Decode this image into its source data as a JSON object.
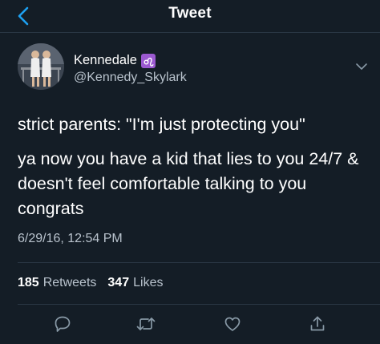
{
  "nav": {
    "title": "Tweet"
  },
  "user": {
    "display_name": "Kennedale",
    "handle": "@Kennedy_Skylark",
    "badge_icon": "leo-zodiac-icon",
    "badge_color": "#9b59d0"
  },
  "tweet": {
    "paragraphs": [
      "strict parents: \"I'm just protecting you\"",
      "ya now you have a kid that lies to you 24/7 & doesn't feel comfortable talking to you congrats"
    ],
    "timestamp": "6/29/16, 12:54 PM"
  },
  "stats": {
    "retweets_count": "185",
    "retweets_label": "Retweets",
    "likes_count": "347",
    "likes_label": "Likes"
  },
  "actions": [
    "reply-icon",
    "retweet-icon",
    "like-icon",
    "share-icon"
  ],
  "colors": {
    "background": "#141d26",
    "accent": "#1da1f2",
    "muted": "#b9c3cd",
    "divider": "#2a3744"
  }
}
